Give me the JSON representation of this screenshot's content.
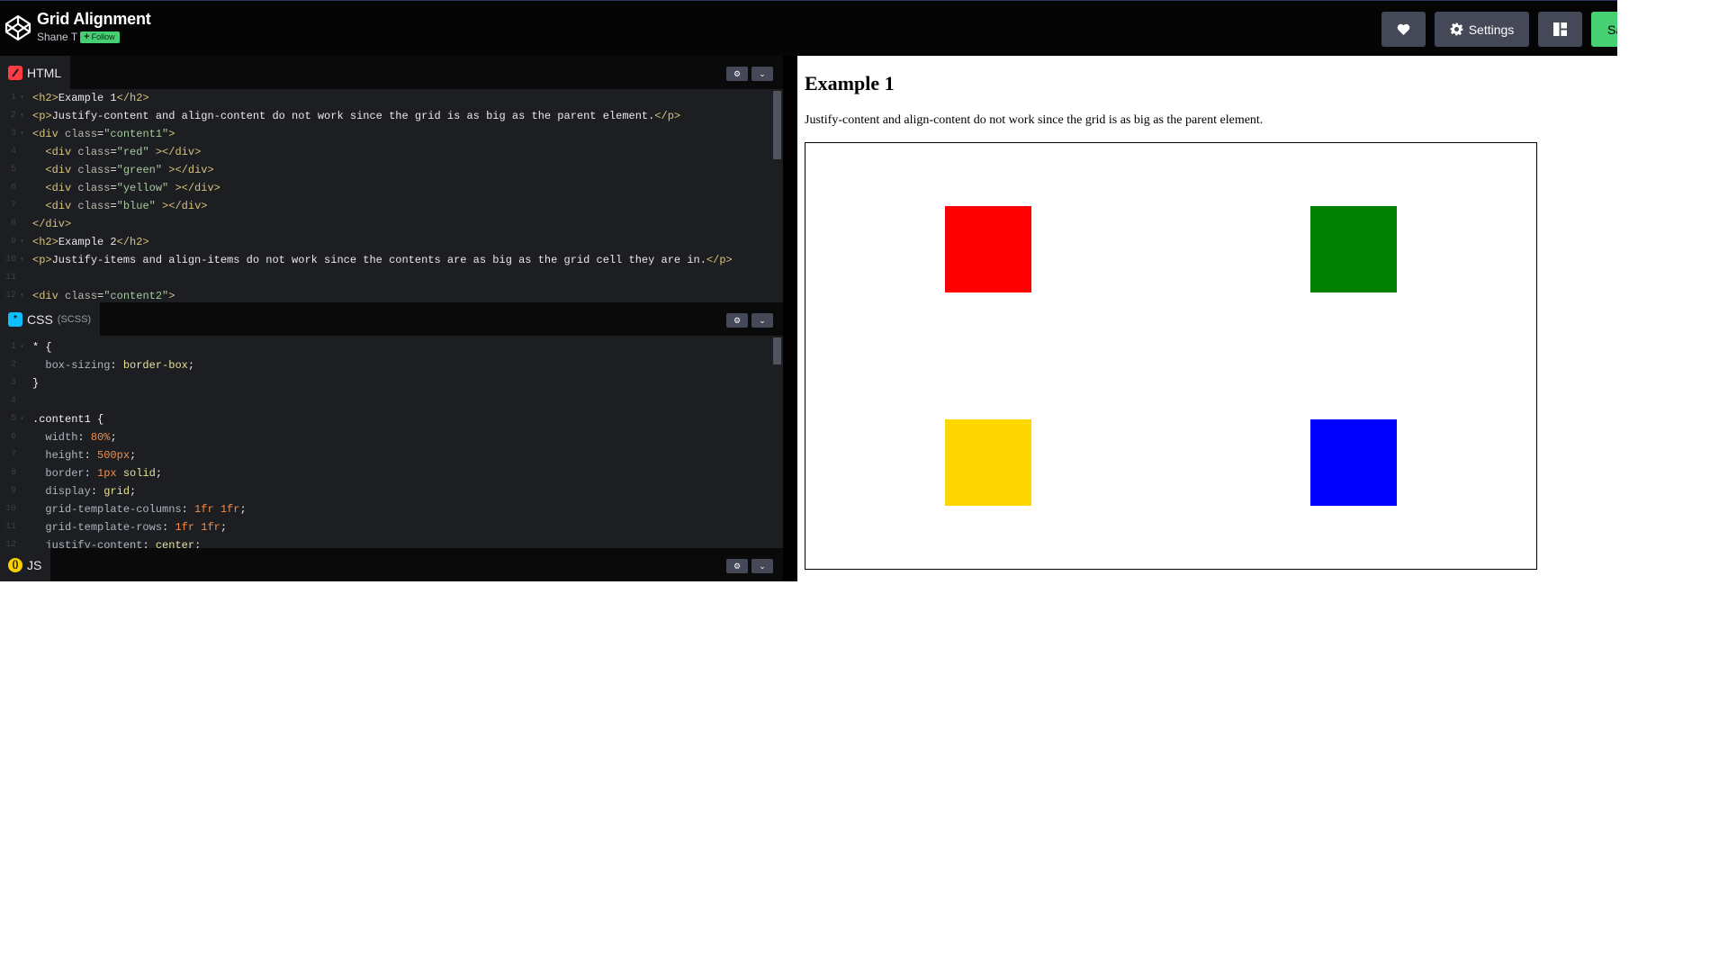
{
  "header": {
    "title": "Grid Alignment",
    "author": "Shane T",
    "follow_label": "Follow",
    "heart_icon": "heart-icon",
    "settings_label": "Settings",
    "save_label": "Save"
  },
  "panels": {
    "html": {
      "label": "HTML",
      "badge_color": "#ff3c41"
    },
    "css": {
      "label": "CSS",
      "sublabel": "(SCSS)",
      "badge_color": "#0ebeff"
    },
    "js": {
      "label": "JS",
      "badge_color": "#fcd000"
    }
  },
  "html_code": [
    {
      "n": "1",
      "fold": "▾",
      "parts": [
        [
          "tag",
          "<h2>"
        ],
        [
          "txt",
          "Example 1"
        ],
        [
          "tag",
          "</h2>"
        ]
      ]
    },
    {
      "n": "2",
      "fold": "▾",
      "parts": [
        [
          "tag",
          "<p>"
        ],
        [
          "txt",
          "Justify-content and align-content do not work since the grid is as big as the parent element."
        ],
        [
          "tag",
          "</p>"
        ]
      ]
    },
    {
      "n": "3",
      "fold": "▾",
      "parts": [
        [
          "tag",
          "<div "
        ],
        [
          "atn",
          "class"
        ],
        [
          "txt",
          "="
        ],
        [
          "str",
          "\"content1\""
        ],
        [
          "tag",
          ">"
        ]
      ]
    },
    {
      "n": "4",
      "fold": "",
      "parts": [
        [
          "txt",
          "  "
        ],
        [
          "tag",
          "<div "
        ],
        [
          "atn",
          "class"
        ],
        [
          "txt",
          "="
        ],
        [
          "str",
          "\"red\""
        ],
        [
          "tag",
          " ></div>"
        ]
      ]
    },
    {
      "n": "5",
      "fold": "",
      "parts": [
        [
          "txt",
          "  "
        ],
        [
          "tag",
          "<div "
        ],
        [
          "atn",
          "class"
        ],
        [
          "txt",
          "="
        ],
        [
          "str",
          "\"green\""
        ],
        [
          "tag",
          " ></div>"
        ]
      ]
    },
    {
      "n": "6",
      "fold": "",
      "parts": [
        [
          "txt",
          "  "
        ],
        [
          "tag",
          "<div "
        ],
        [
          "atn",
          "class"
        ],
        [
          "txt",
          "="
        ],
        [
          "str",
          "\"yellow\""
        ],
        [
          "tag",
          " ></div>"
        ]
      ]
    },
    {
      "n": "7",
      "fold": "",
      "parts": [
        [
          "txt",
          "  "
        ],
        [
          "tag",
          "<div "
        ],
        [
          "atn",
          "class"
        ],
        [
          "txt",
          "="
        ],
        [
          "str",
          "\"blue\""
        ],
        [
          "tag",
          " ></div>"
        ]
      ]
    },
    {
      "n": "8",
      "fold": "",
      "parts": [
        [
          "tag",
          "</div>"
        ]
      ]
    },
    {
      "n": "9",
      "fold": "▾",
      "parts": [
        [
          "tag",
          "<h2>"
        ],
        [
          "txt",
          "Example 2"
        ],
        [
          "tag",
          "</h2>"
        ]
      ]
    },
    {
      "n": "10",
      "fold": "▾",
      "parts": [
        [
          "tag",
          "<p>"
        ],
        [
          "txt",
          "Justify-items and align-items do not work since the contents are as big as the grid cell they are in."
        ],
        [
          "tag",
          "</p>"
        ]
      ]
    },
    {
      "n": "11",
      "fold": "",
      "parts": []
    },
    {
      "n": "12",
      "fold": "▾",
      "parts": [
        [
          "tag",
          "<div "
        ],
        [
          "atn",
          "class"
        ],
        [
          "txt",
          "="
        ],
        [
          "str",
          "\"content2\""
        ],
        [
          "tag",
          ">"
        ]
      ]
    }
  ],
  "css_code": [
    {
      "n": "1",
      "fold": "▾",
      "parts": [
        [
          "sel",
          "* {"
        ]
      ]
    },
    {
      "n": "2",
      "fold": "",
      "parts": [
        [
          "txt",
          "  "
        ],
        [
          "prop",
          "box-sizing"
        ],
        [
          "txt",
          ": "
        ],
        [
          "val",
          "border-box"
        ],
        [
          "txt",
          ";"
        ]
      ]
    },
    {
      "n": "3",
      "fold": "",
      "parts": [
        [
          "sel",
          "}"
        ]
      ]
    },
    {
      "n": "4",
      "fold": "",
      "parts": []
    },
    {
      "n": "5",
      "fold": "▾",
      "parts": [
        [
          "sel",
          ".content1 {"
        ]
      ]
    },
    {
      "n": "6",
      "fold": "",
      "parts": [
        [
          "txt",
          "  "
        ],
        [
          "prop",
          "width"
        ],
        [
          "txt",
          ": "
        ],
        [
          "num",
          "80%"
        ],
        [
          "txt",
          ";"
        ]
      ]
    },
    {
      "n": "7",
      "fold": "",
      "parts": [
        [
          "txt",
          "  "
        ],
        [
          "prop",
          "height"
        ],
        [
          "txt",
          ": "
        ],
        [
          "num",
          "500px"
        ],
        [
          "txt",
          ";"
        ]
      ]
    },
    {
      "n": "8",
      "fold": "",
      "parts": [
        [
          "txt",
          "  "
        ],
        [
          "prop",
          "border"
        ],
        [
          "txt",
          ": "
        ],
        [
          "num",
          "1px"
        ],
        [
          "txt",
          " "
        ],
        [
          "val",
          "solid"
        ],
        [
          "txt",
          ";"
        ]
      ]
    },
    {
      "n": "9",
      "fold": "",
      "parts": [
        [
          "txt",
          "  "
        ],
        [
          "prop",
          "display"
        ],
        [
          "txt",
          ": "
        ],
        [
          "val",
          "grid"
        ],
        [
          "txt",
          ";"
        ]
      ]
    },
    {
      "n": "10",
      "fold": "",
      "parts": [
        [
          "txt",
          "  "
        ],
        [
          "prop",
          "grid-template-columns"
        ],
        [
          "txt",
          ": "
        ],
        [
          "num",
          "1fr 1fr"
        ],
        [
          "txt",
          ";"
        ]
      ]
    },
    {
      "n": "11",
      "fold": "",
      "parts": [
        [
          "txt",
          "  "
        ],
        [
          "prop",
          "grid-template-rows"
        ],
        [
          "txt",
          ": "
        ],
        [
          "num",
          "1fr 1fr"
        ],
        [
          "txt",
          ";"
        ]
      ]
    },
    {
      "n": "12",
      "fold": "",
      "parts": [
        [
          "txt",
          "  "
        ],
        [
          "prop",
          "justify-content"
        ],
        [
          "txt",
          ": "
        ],
        [
          "val",
          "center"
        ],
        [
          "txt",
          ";"
        ]
      ]
    }
  ],
  "preview": {
    "heading": "Example 1",
    "paragraph": "Justify-content and align-content do not work since the grid is as big as the parent element.",
    "squares": [
      {
        "name": "red",
        "color": "#ff0000"
      },
      {
        "name": "green",
        "color": "#008000"
      },
      {
        "name": "yellow",
        "color": "#ffd700"
      },
      {
        "name": "blue",
        "color": "#0000ff"
      }
    ]
  }
}
